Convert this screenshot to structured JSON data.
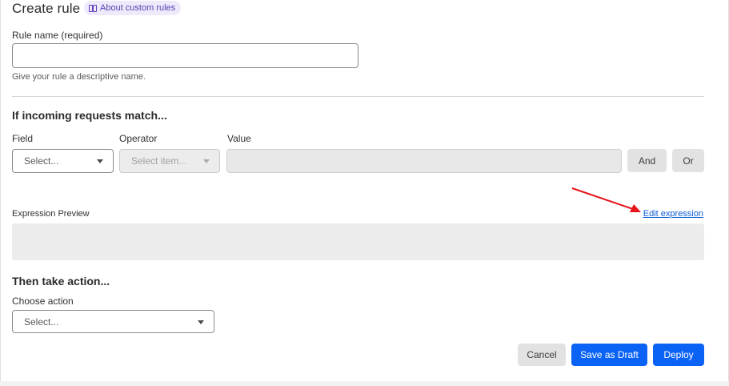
{
  "header": {
    "title": "Create rule",
    "about_link": "About custom rules",
    "about_icon": "book-icon"
  },
  "rule_name": {
    "label": "Rule name (required)",
    "value": "",
    "placeholder": "",
    "hint": "Give your rule a descriptive name."
  },
  "match": {
    "section_title": "If incoming requests match...",
    "field_label": "Field",
    "field_value": "Select...",
    "operator_label": "Operator",
    "operator_value": "Select item...",
    "value_label": "Value",
    "value": "",
    "and_label": "And",
    "or_label": "Or"
  },
  "expression": {
    "label": "Expression Preview",
    "edit_link": "Edit expression",
    "content": ""
  },
  "action": {
    "section_title": "Then take action...",
    "choose_label": "Choose action",
    "choose_value": "Select..."
  },
  "footer": {
    "cancel_label": "Cancel",
    "draft_label": "Save as Draft",
    "deploy_label": "Deploy"
  },
  "colors": {
    "accent": "#0b63f6",
    "arrow": "#e5151a",
    "pill_bg": "#efe9fb",
    "pill_text": "#5b3fb3"
  }
}
